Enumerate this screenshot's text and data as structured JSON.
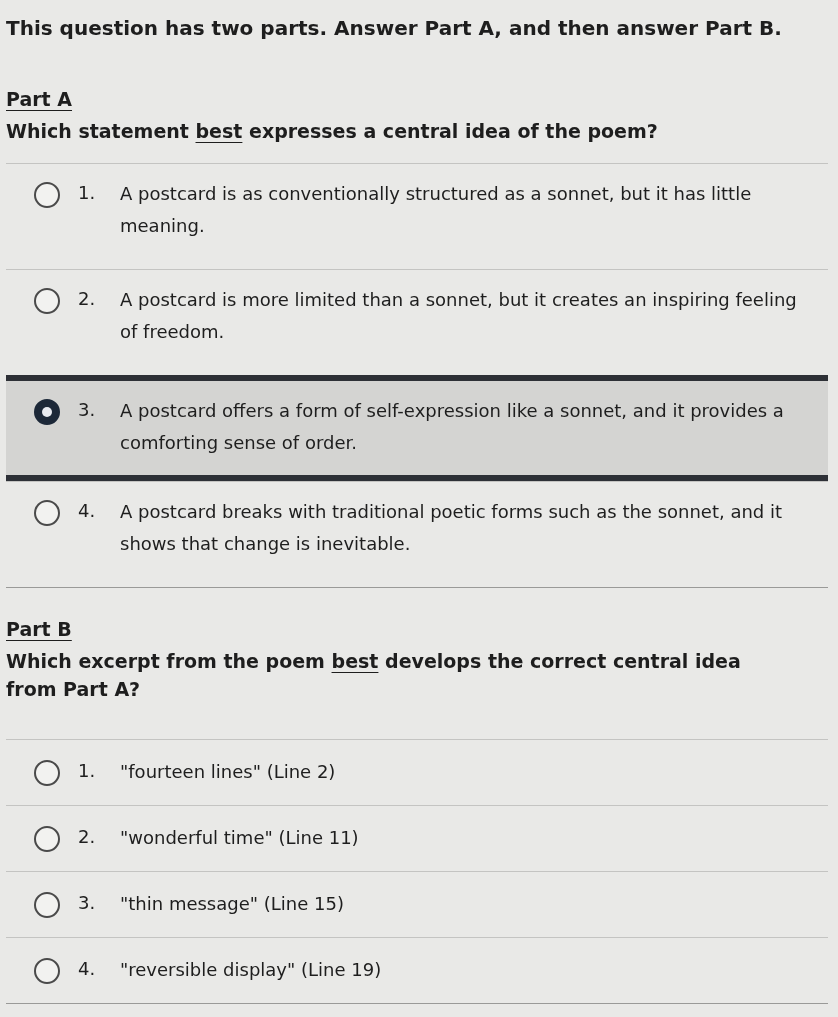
{
  "instructions": "This question has two parts. Answer Part A, and then answer Part B.",
  "parts": [
    {
      "heading": "Part A",
      "question": [
        "Which statement ",
        "best",
        " expresses a central idea of the poem?"
      ],
      "options": [
        {
          "number": "1.",
          "text": "A postcard is as conventionally structured as a sonnet, but it has little meaning.",
          "selected": false
        },
        {
          "number": "2.",
          "text": "A postcard is more limited than a sonnet, but it creates an inspiring feeling of freedom.",
          "selected": false
        },
        {
          "number": "3.",
          "text": "A postcard offers a form of self-expression like a sonnet, and it provides a comforting sense of order.",
          "selected": true
        },
        {
          "number": "4.",
          "text": "A postcard breaks with traditional poetic forms such as the sonnet, and it shows that change is inevitable.",
          "selected": false
        }
      ]
    },
    {
      "heading": "Part B",
      "question": [
        "Which excerpt from the poem ",
        "best",
        " develops the correct central idea from Part A?"
      ],
      "options": [
        {
          "number": "1.",
          "text": "\"fourteen lines\" (Line 2)",
          "selected": false
        },
        {
          "number": "2.",
          "text": "\"wonderful time\" (Line 11)",
          "selected": false
        },
        {
          "number": "3.",
          "text": "\"thin message\" (Line 15)",
          "selected": false
        },
        {
          "number": "4.",
          "text": "\"reversible display\" (Line 19)",
          "selected": false
        }
      ]
    }
  ]
}
